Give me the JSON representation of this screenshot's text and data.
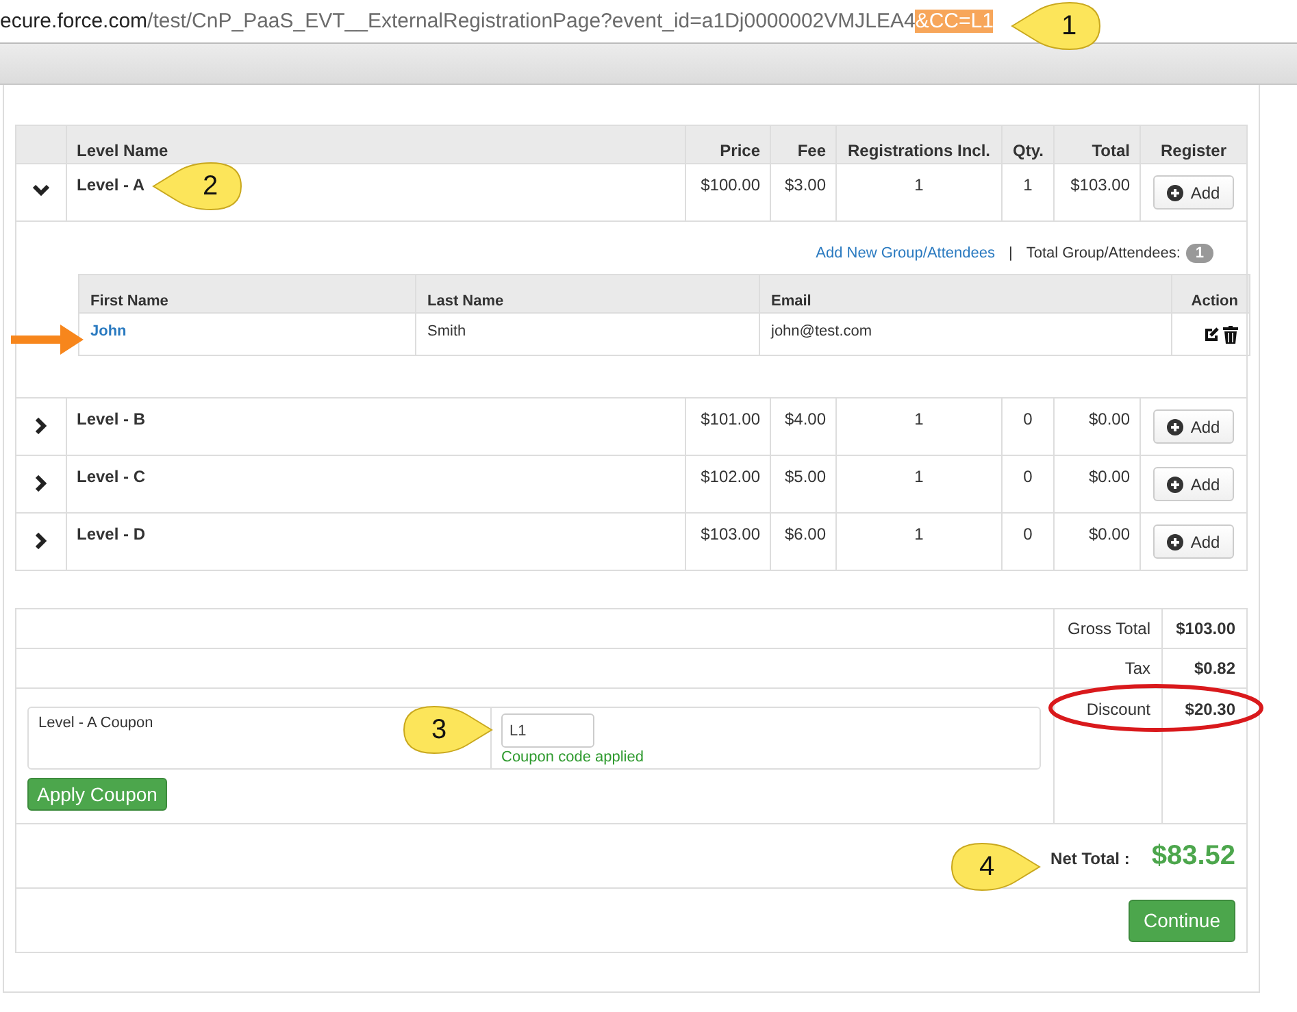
{
  "address_bar": {
    "host": "ecure.force.com",
    "path": "/test/CnP_PaaS_EVT__ExternalRegistrationPage?event_id=a1Dj0000002VMJLEA4",
    "highlight": "&CC=L1"
  },
  "levels": {
    "columns": [
      "Level Name",
      "Price",
      "Fee",
      "Registrations Incl.",
      "Qty.",
      "Total",
      "Register"
    ],
    "rows": [
      {
        "name": "Level - A",
        "price": "$100.00",
        "fee": "$3.00",
        "registrations": "1",
        "qty": "1",
        "total": "$103.00",
        "button": "Add",
        "expanded": true
      },
      {
        "name": "Level - B",
        "price": "$101.00",
        "fee": "$4.00",
        "registrations": "1",
        "qty": "0",
        "total": "$0.00",
        "button": "Add",
        "expanded": false
      },
      {
        "name": "Level - C",
        "price": "$102.00",
        "fee": "$5.00",
        "registrations": "1",
        "qty": "0",
        "total": "$0.00",
        "button": "Add",
        "expanded": false
      },
      {
        "name": "Level - D",
        "price": "$103.00",
        "fee": "$6.00",
        "registrations": "1",
        "qty": "0",
        "total": "$0.00",
        "button": "Add",
        "expanded": false
      }
    ],
    "attendees": {
      "add_link": "Add New Group/Attendees",
      "separator": "|",
      "total_label": "Total Group/Attendees:",
      "total_count": "1",
      "columns": [
        "First Name",
        "Last Name",
        "Email",
        "Action"
      ],
      "rows": [
        {
          "first_name": "John",
          "last_name": "Smith",
          "email": "john@test.com"
        }
      ]
    }
  },
  "summary": {
    "lines": [
      {
        "label": "Gross Total",
        "value": "$103.00"
      },
      {
        "label": "Tax",
        "value": "$0.82"
      },
      {
        "label": "Discount",
        "value": "$20.30"
      }
    ],
    "coupon": {
      "label": "Level - A Coupon",
      "value": "L1",
      "status": "Coupon code applied"
    },
    "apply_button": "Apply Coupon",
    "net_label": "Net Total :",
    "net_value": "$83.52",
    "continue_button": "Continue"
  },
  "callouts": [
    {
      "number": "1"
    },
    {
      "number": "2"
    },
    {
      "number": "3"
    },
    {
      "number": "4"
    }
  ]
}
